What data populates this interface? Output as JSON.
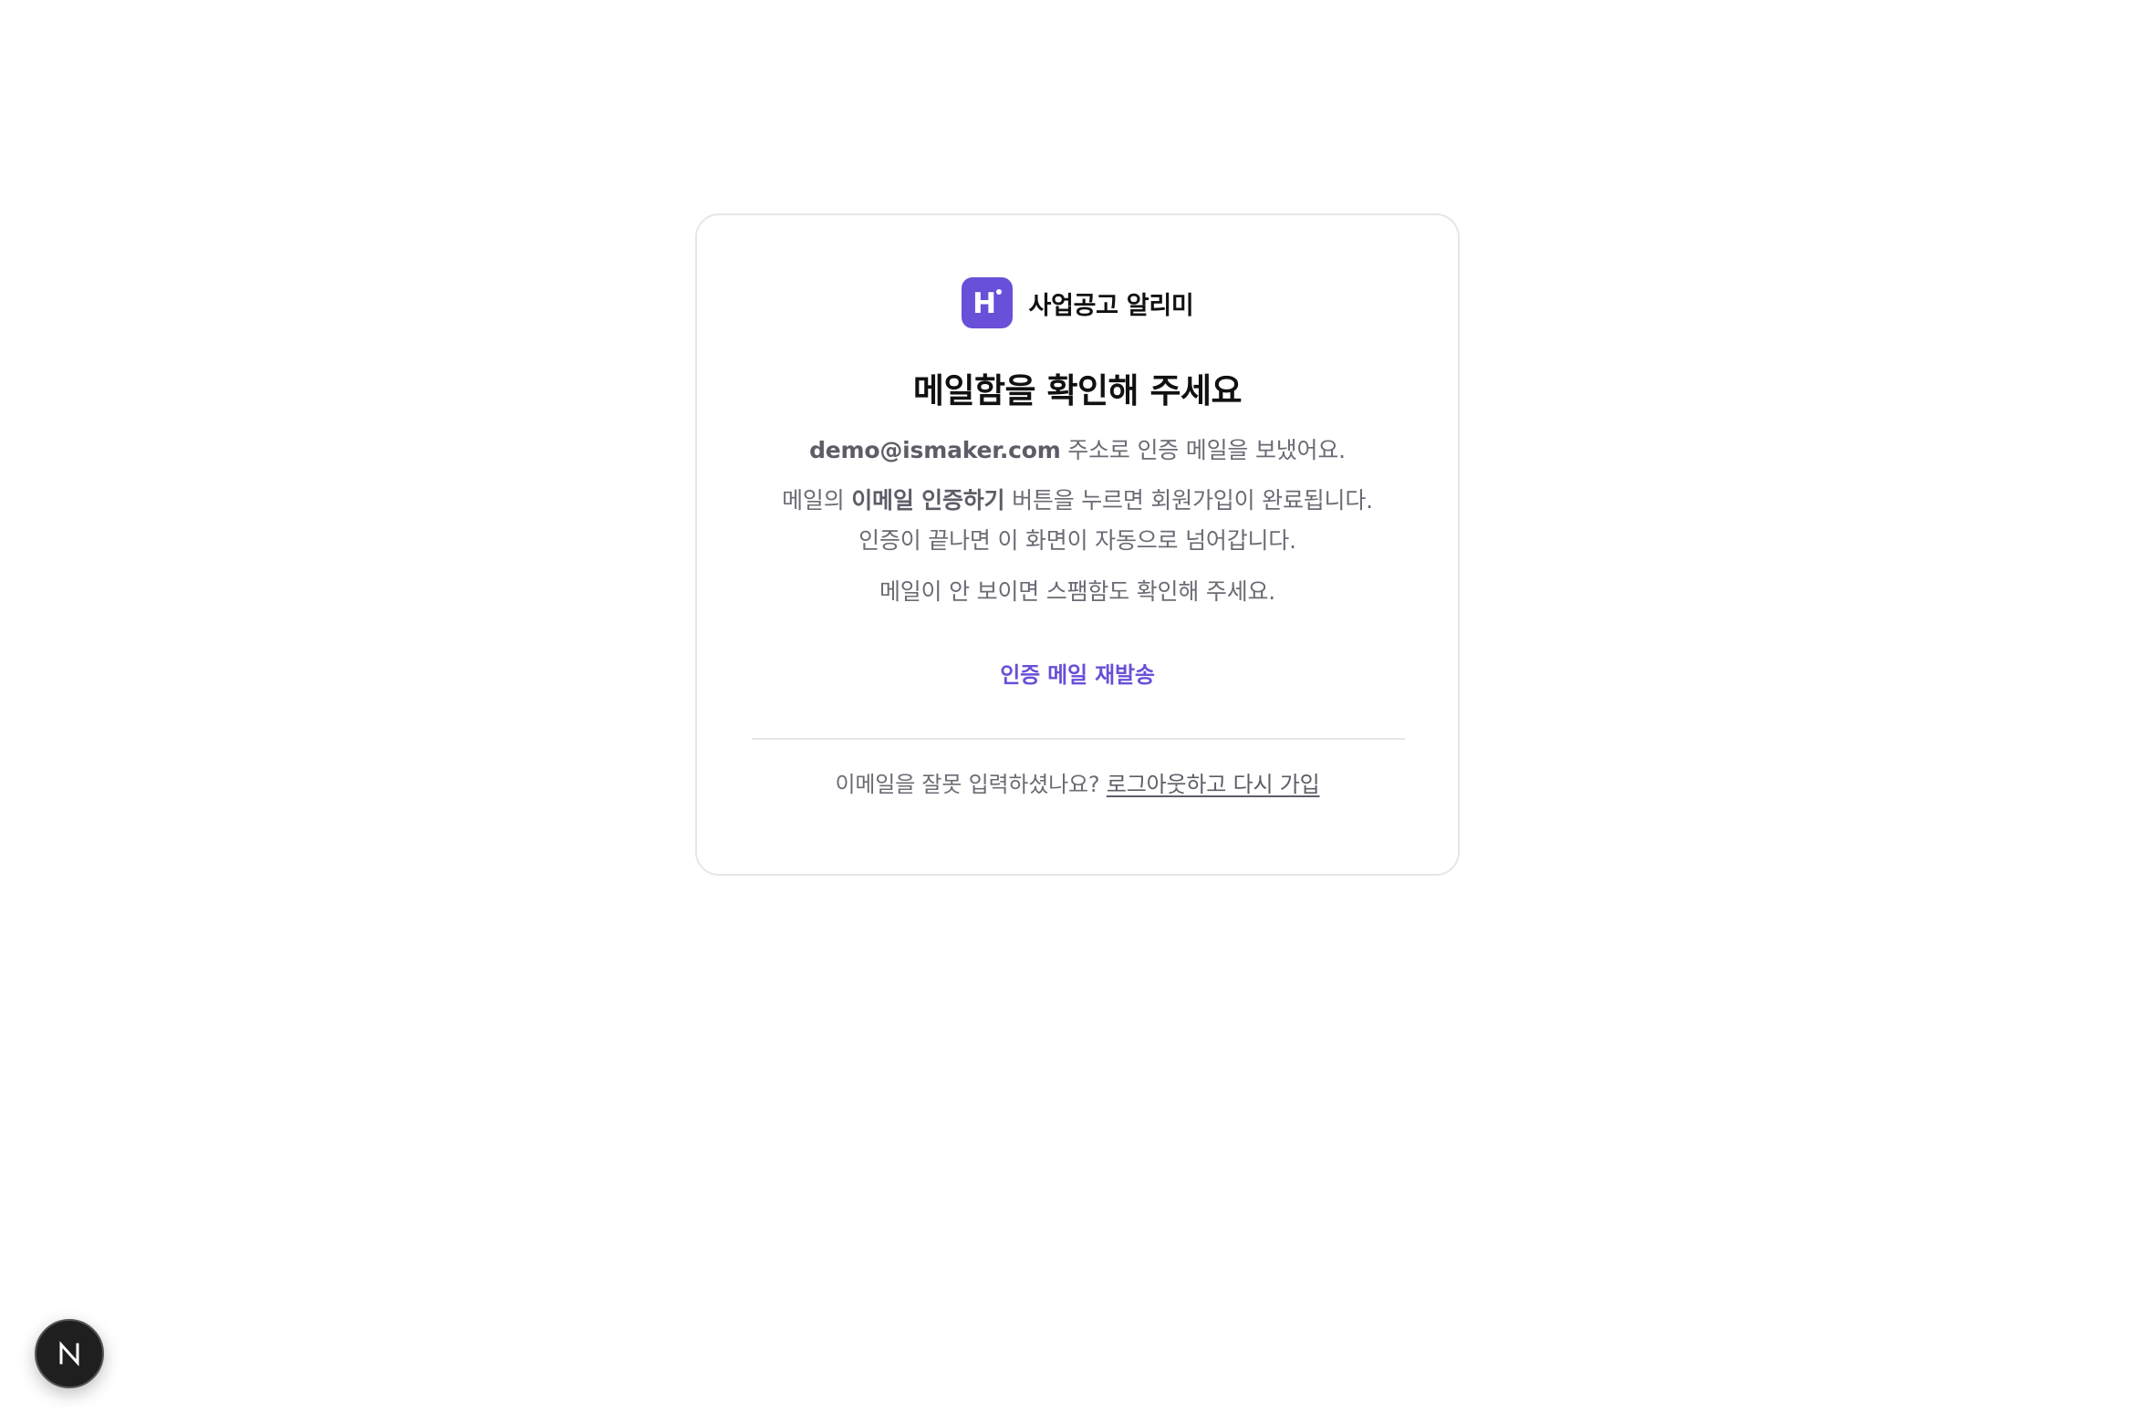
{
  "brand": {
    "logo_letter": "H",
    "name": "사업공고 알리미",
    "accent_color": "#6a4fd8"
  },
  "main": {
    "title": "메일함을 확인해 주세요",
    "line1": {
      "email": "demo@ismaker.com",
      "rest": " 주소로 인증 메일을 보냈어요."
    },
    "line2": {
      "prefix": "메일의 ",
      "bold": "이메일 인증하기",
      "suffix": " 버튼을 누르면 회원가입이 완료됩니다."
    },
    "line3": "인증이 끝나면 이 화면이 자동으로 넘어갑니다.",
    "line4": "메일이 안 보이면 스팸함도 확인해 주세요.",
    "resend_label": "인증 메일 재발송"
  },
  "footer": {
    "question": "이메일을 잘못 입력하셨나요? ",
    "link_label": "로그아웃하고 다시 가입"
  },
  "dev_badge": {
    "icon": "nextjs-n-icon"
  }
}
